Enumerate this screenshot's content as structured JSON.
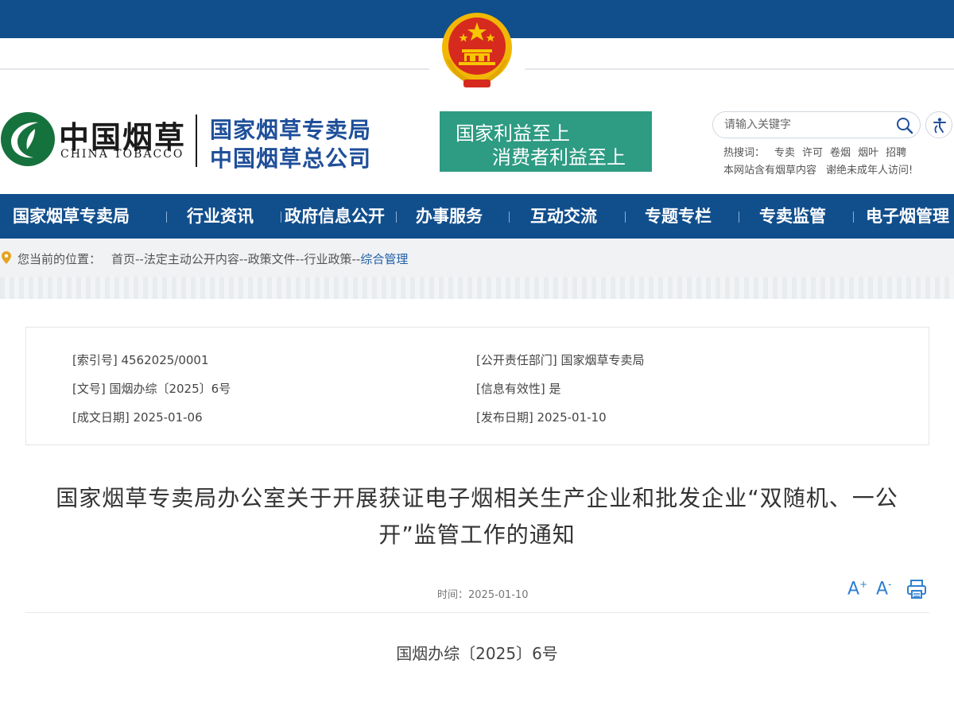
{
  "header": {
    "logo": {
      "name_cn": "中国烟草",
      "name_en": "CHINA TOBACCO",
      "org_line1": "国家烟草专卖局",
      "org_line2": "中国烟草总公司"
    },
    "slogan": {
      "line1": "国家利益至上",
      "line2": "消费者利益至上"
    },
    "search": {
      "placeholder": "请输入关键字"
    },
    "hot_words": {
      "label": "热搜词：",
      "items": [
        "专卖",
        "许可",
        "卷烟",
        "烟叶",
        "招聘"
      ]
    },
    "notice": {
      "left": "本网站含有烟草内容",
      "right": "谢绝未成年人访问!"
    }
  },
  "nav": {
    "items": [
      {
        "label": "国家烟草专卖局"
      },
      {
        "label": "行业资讯"
      },
      {
        "label": "政府信息公开"
      },
      {
        "label": "办事服务"
      },
      {
        "label": "互动交流"
      },
      {
        "label": "专题专栏"
      },
      {
        "label": "专卖监管"
      },
      {
        "label": "电子烟管理"
      }
    ]
  },
  "breadcrumb": {
    "label": "您当前的位置：",
    "path": "首页--法定主动公开内容--政策文件--行业政策--",
    "current": "综合管理"
  },
  "info": {
    "index_no": "[索引号] 4562025/0001",
    "department": "[公开责任部门] 国家烟草专卖局",
    "doc_no": "[文号] 国烟办综〔2025〕6号",
    "validity": "[信息有效性] 是",
    "written_date": "[成文日期] 2025-01-06",
    "publish_date": "[发布日期] 2025-01-10"
  },
  "article": {
    "title": "国家烟草专卖局办公室关于开展获证电子烟相关生产企业和批发企业“双随机、一公开”监管工作的通知",
    "time_label": "时间：",
    "time": "2025-01-10",
    "doc_no": "国烟办综〔2025〕6号"
  },
  "colors": {
    "brand_blue": "#114e8c",
    "slogan_green": "#2e9b83",
    "link_blue": "#1f5fa6",
    "tool_blue": "#2f80d1"
  },
  "icons": [
    "national-emblem-icon",
    "tobacco-leaf-logo-icon",
    "search-icon",
    "accessibility-icon",
    "location-pin-icon",
    "font-increase-icon",
    "font-decrease-icon",
    "print-icon"
  ]
}
